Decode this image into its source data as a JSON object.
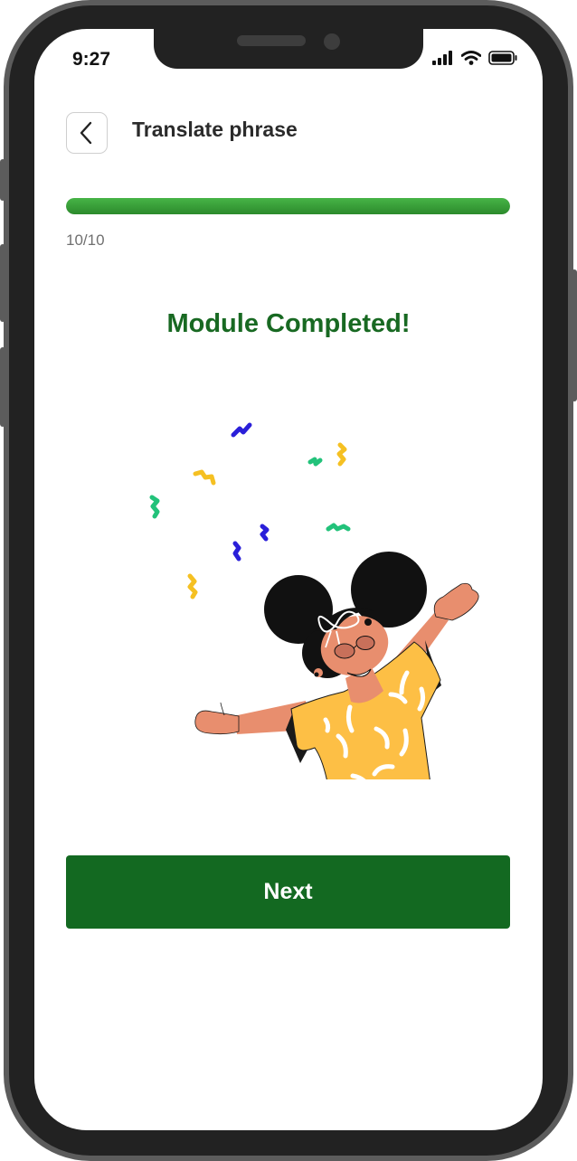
{
  "status_bar": {
    "time": "9:27"
  },
  "header": {
    "title": "Translate phrase"
  },
  "progress": {
    "label": "10/10",
    "current": 10,
    "total": 10
  },
  "main": {
    "heading": "Module Completed!"
  },
  "actions": {
    "next_label": "Next"
  },
  "colors": {
    "heading_green": "#186922",
    "button_green": "#136921",
    "progress_green": "#3a9e3a",
    "shirt_yellow": "#FDBF45",
    "skin": "#E88E6E",
    "confetti_blue": "#2A1FD9",
    "confetti_green": "#22C27A",
    "confetti_yellow": "#F5C022"
  },
  "icons": [
    "back-chevron-icon",
    "signal-icon",
    "wifi-icon",
    "battery-icon"
  ]
}
